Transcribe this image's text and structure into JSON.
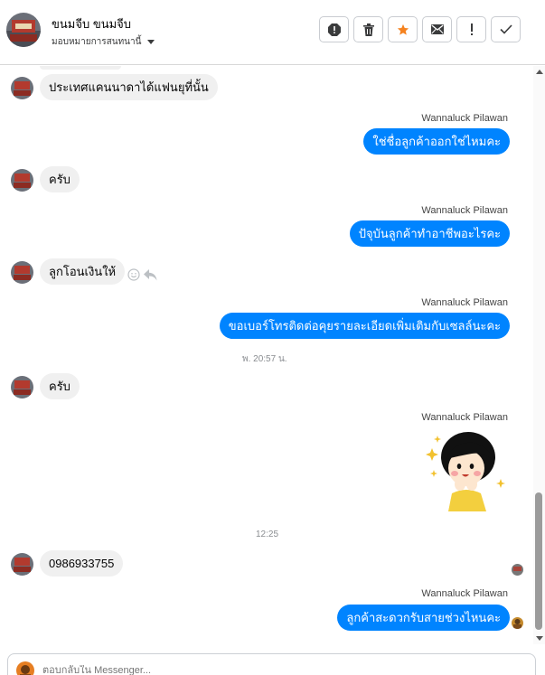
{
  "header": {
    "contact_name": "ขนมจีบ ขนมจีบ",
    "assign_label": "มอบหมายการสนทนานี้"
  },
  "toolbar": {
    "buttons": [
      "report-icon",
      "trash-icon",
      "star-icon",
      "mail-icon",
      "exclamation-icon",
      "check-icon"
    ],
    "star_color": "#f5821f"
  },
  "colors": {
    "outgoing_bubble": "#0084ff",
    "incoming_bubble": "#f0f0f0"
  },
  "messages": {
    "m1": "ประเทศแคนนาดาได้แฟนยุที่นั้น",
    "m2_sender": "Wannaluck Pilawan",
    "m2": "ใช่ชื่อลูกค้าออกใช่ไหมคะ",
    "m3": "ครับ",
    "m4_sender": "Wannaluck Pilawan",
    "m4": "ปัจุบันลูกค้าทำอาชีพอะไรคะ",
    "m5": "ลูกโอนเงินให้",
    "m6_sender": "Wannaluck Pilawan",
    "m6": "ขอเบอร์โทรติดต่อคุยรายละเอียดเพิ่มเติมกับเซลล์นะคะ",
    "time1": "พ. 20:57 น.",
    "m7": "ครับ",
    "m8_sender": "Wannaluck Pilawan",
    "time2": "12:25",
    "m9": "0986933755",
    "m10_sender": "Wannaluck Pilawan",
    "m10": "ลูกค้าสะดวกรับสายช่วงไหนคะ"
  },
  "composer": {
    "placeholder": "ตอบกลับใน Messenger..."
  }
}
